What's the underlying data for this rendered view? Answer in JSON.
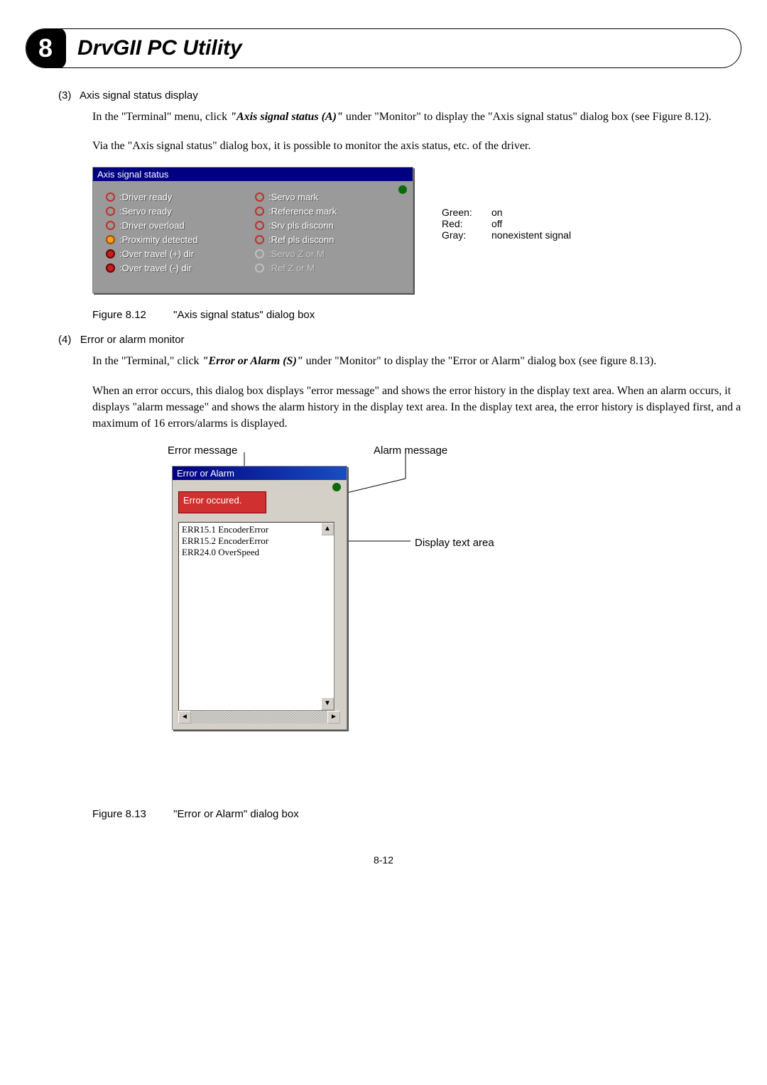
{
  "chapter": {
    "number": "8",
    "title": "DrvGII PC Utility"
  },
  "section3": {
    "heading_num": "(3)",
    "heading_txt": "Axis signal status display",
    "p1_a": "In the \"Terminal\" menu, click ",
    "p1_b": "\"Axis signal status (A)\"",
    "p1_c": " under \"Monitor\" to display the \"Axis signal status\" dialog box (see Figure 8.12).",
    "p2": "Via the \"Axis signal status\" dialog box, it is possible to monitor the axis status, etc. of the driver."
  },
  "axis_dialog": {
    "title": "Axis signal status",
    "left_items": [
      {
        "led": "red-open",
        "label": ":Driver ready"
      },
      {
        "led": "red-open",
        "label": ":Servo ready"
      },
      {
        "led": "red-open",
        "label": ":Driver overload"
      },
      {
        "led": "orange",
        "label": ":Proximity detected"
      },
      {
        "led": "red-filled",
        "label": ":Over travel (+) dir"
      },
      {
        "led": "red-filled",
        "label": ":Over travel (-) dir"
      }
    ],
    "right_items": [
      {
        "led": "red-open",
        "dim": false,
        "label": ":Servo mark"
      },
      {
        "led": "red-open",
        "dim": false,
        "label": ":Reference mark"
      },
      {
        "led": "red-open",
        "dim": false,
        "label": ":Srv pls disconn"
      },
      {
        "led": "red-open",
        "dim": false,
        "label": ":Ref pls disconn"
      },
      {
        "led": "gray-open",
        "dim": true,
        "label": ":Servo Z or M"
      },
      {
        "led": "gray-open",
        "dim": true,
        "label": ":Ref Z or M"
      }
    ]
  },
  "legend": {
    "rows": [
      {
        "key": "Green:",
        "val": "on"
      },
      {
        "key": "Red:",
        "val": "off"
      },
      {
        "key": "Gray:",
        "val": "nonexistent signal"
      }
    ]
  },
  "fig812": {
    "num": "Figure 8.12",
    "txt": "\"Axis signal status\" dialog box"
  },
  "section4": {
    "heading_num": "(4)",
    "heading_txt": "Error or alarm monitor",
    "p1_a": "In the \"Terminal,\" click ",
    "p1_b": "\"Error or Alarm (S)\"",
    "p1_c": " under \"Monitor\" to display the \"Error or Alarm\" dialog box (see figure 8.13).",
    "p2": "When an error occurs, this dialog box displays \"error message\" and shows the error history in the display text area. When an alarm occurs, it displays \"alarm message\" and shows the alarm history in the display text area. In the display text area, the error history is displayed first, and a maximum of 16 errors/alarms is displayed."
  },
  "err_dialog": {
    "title": "Error or Alarm",
    "banner": "Error occured.",
    "lines": [
      "ERR15.1 EncoderError",
      "ERR15.2 EncoderError",
      "ERR24.0 OverSpeed"
    ]
  },
  "annotations": {
    "error_msg": "Error message",
    "alarm_msg": "Alarm message",
    "display_ta": "Display text area"
  },
  "fig813": {
    "num": "Figure 8.13",
    "txt": "\"Error or Alarm\" dialog box"
  },
  "page_number": "8-12"
}
